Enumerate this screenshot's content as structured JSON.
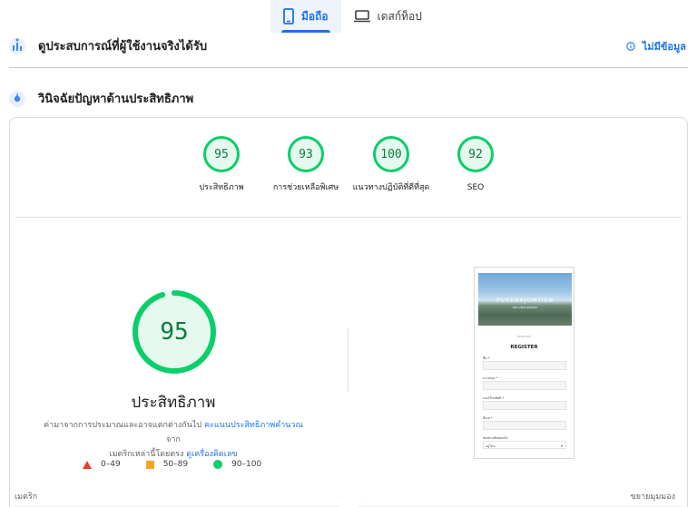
{
  "tabs": [
    {
      "label": "มือถือ",
      "icon": "smartphone-icon",
      "active": true
    },
    {
      "label": "เดสก์ท็อป",
      "icon": "laptop-icon",
      "active": false
    }
  ],
  "field_data": {
    "title": "ดูประสบการณ์ที่ผู้ใช้งานจริงได้รับ",
    "status": "ไม่มีข้อมูล"
  },
  "lab": {
    "title": "วินิจฉัยปัญหาด้านประสิทธิภาพ"
  },
  "gauges": [
    {
      "score": "95",
      "label": "ประสิทธิภาพ"
    },
    {
      "score": "93",
      "label": "การช่วยเหลือพิเศษ"
    },
    {
      "score": "100",
      "label": "แนวทางปฏิบัติที่ดีที่สุด"
    },
    {
      "score": "92",
      "label": "SEO"
    }
  ],
  "performance": {
    "score": "95",
    "score_fraction": 0.95,
    "title": "ประสิทธิภาพ",
    "desc_1": "ค่ามาจากการประมาณและอาจแตกต่างกันไป",
    "link_1": "คะแนนประสิทธิภาพคำนวณ",
    "desc_2": "จาก",
    "desc_3": "เมตริกเหล่านี้โดยตรง",
    "link_2": "ดูเครื่องคิดเลข"
  },
  "legend": [
    {
      "range": "0–49",
      "color": "#eb3b2d"
    },
    {
      "range": "50–89",
      "color": "#f5a623"
    },
    {
      "range": "90–100",
      "color": "#0cce6b"
    }
  ],
  "screenshot": {
    "brand": "PURENAJOMTIEN",
    "sub": "SEA VIEW RESORT",
    "small_label": "REGISTER",
    "heading": "REGISTER",
    "fields": [
      "ชื่อ *",
      "นามสกุล *",
      "เบอร์โทรศัพท์ *",
      "อีเมล *"
    ],
    "select_label": "ช่องทางติดต่อกลับ",
    "select_value": "อยู่ไหน"
  },
  "footer": {
    "metrics_label": "เมตริก",
    "expand_label": "ขยายมุมมอง"
  }
}
